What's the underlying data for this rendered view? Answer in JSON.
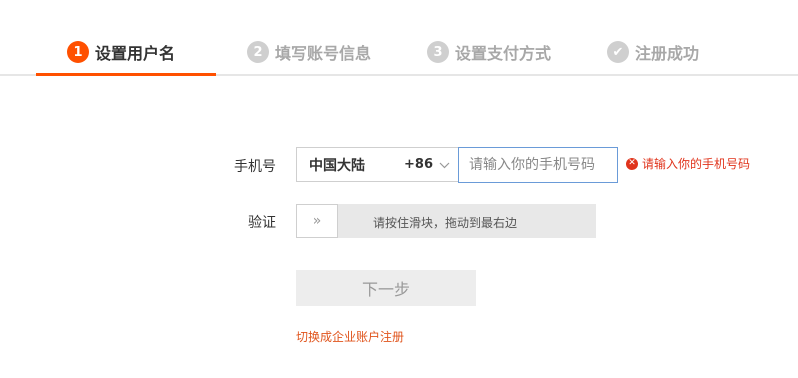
{
  "steps": [
    {
      "num": "1",
      "label": "设置用户名",
      "state": "active"
    },
    {
      "num": "2",
      "label": "填写账号信息",
      "state": "inactive"
    },
    {
      "num": "3",
      "label": "设置支付方式",
      "state": "inactive"
    },
    {
      "num": "✔",
      "label": "注册成功",
      "state": "inactive"
    }
  ],
  "form": {
    "phone_label": "手机号",
    "region_name": "中国大陆",
    "region_code": "+86",
    "phone_placeholder": "请输入你的手机号码",
    "phone_value": "",
    "error_text": "请输入你的手机号码",
    "verify_label": "验证",
    "slider_text": "请按住滑块，拖动到最右边",
    "slider_handle_glyph": "»",
    "next_label": "下一步",
    "switch_link": "切换成企业账户注册"
  },
  "colors": {
    "accent": "#ff5000",
    "error": "#e0341c",
    "link": "#e0541c",
    "input_focus_border": "#6a9bd8"
  }
}
